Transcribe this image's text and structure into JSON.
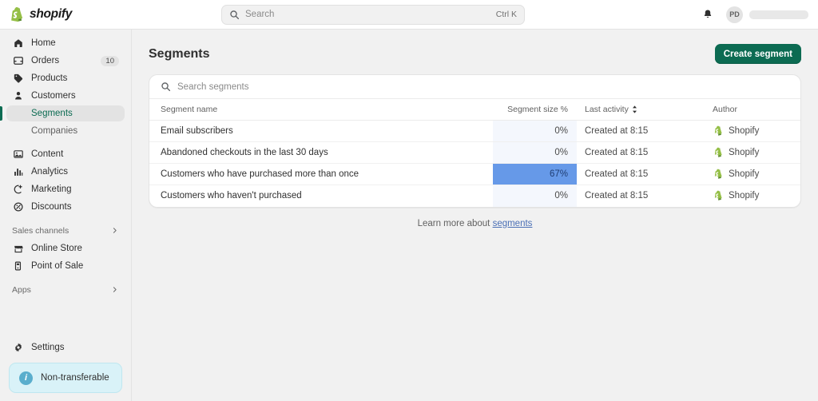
{
  "topbar": {
    "brand_name": "shopify",
    "brand_logo_icon": "shopify-bag-icon",
    "search": {
      "value": "",
      "placeholder": "Search",
      "icon": "search-icon",
      "shortcut": "Ctrl K"
    },
    "notifications_icon": "bell-icon",
    "avatar_initials": "PD",
    "store_name_redacted": ""
  },
  "sidebar": {
    "items": [
      {
        "label": "Home",
        "icon": "home-icon",
        "badge": ""
      },
      {
        "label": "Orders",
        "icon": "orders-icon",
        "badge": "10"
      },
      {
        "label": "Products",
        "icon": "products-icon",
        "badge": ""
      },
      {
        "label": "Customers",
        "icon": "customers-icon",
        "badge": ""
      }
    ],
    "sub_items": [
      {
        "label": "Segments",
        "active": true
      },
      {
        "label": "Companies",
        "active": false
      }
    ],
    "items2": [
      {
        "label": "Content",
        "icon": "content-icon"
      },
      {
        "label": "Analytics",
        "icon": "analytics-icon"
      },
      {
        "label": "Marketing",
        "icon": "marketing-icon"
      },
      {
        "label": "Discounts",
        "icon": "discounts-icon"
      }
    ],
    "sales_channels_label": "Sales channels",
    "channels": [
      {
        "label": "Online Store",
        "icon": "store-icon"
      },
      {
        "label": "Point of Sale",
        "icon": "pos-icon"
      }
    ],
    "apps_label": "Apps",
    "settings": {
      "label": "Settings",
      "icon": "gear-icon"
    },
    "banner": {
      "label": "Non-transferable",
      "icon": "info-icon"
    }
  },
  "main": {
    "page_title": "Segments",
    "create_button": "Create segment",
    "search": {
      "value": "",
      "placeholder": "Search segments",
      "icon": "search-icon"
    },
    "columns": {
      "name": "Segment name",
      "size": "Segment size %",
      "activity": "Last activity",
      "author": "Author"
    },
    "rows": [
      {
        "name": "Email subscribers",
        "size": "0%",
        "size_pct": 0,
        "activity": "Created at 8:15",
        "author": "Shopify"
      },
      {
        "name": "Abandoned checkouts in the last 30 days",
        "size": "0%",
        "size_pct": 0,
        "activity": "Created at 8:15",
        "author": "Shopify"
      },
      {
        "name": "Customers who have purchased more than once",
        "size": "67%",
        "size_pct": 67,
        "activity": "Created at 8:15",
        "author": "Shopify"
      },
      {
        "name": "Customers who haven't purchased",
        "size": "0%",
        "size_pct": 0,
        "activity": "Created at 8:15",
        "author": "Shopify"
      }
    ],
    "learn_prefix": "Learn more about ",
    "learn_link": "segments"
  },
  "colors": {
    "brand_green": "#0c6b52",
    "heat_fill": "#6699e8",
    "heat_empty": "#f4f7fd",
    "banner_bg": "#d9f2f8",
    "link": "#4a6fb5"
  }
}
